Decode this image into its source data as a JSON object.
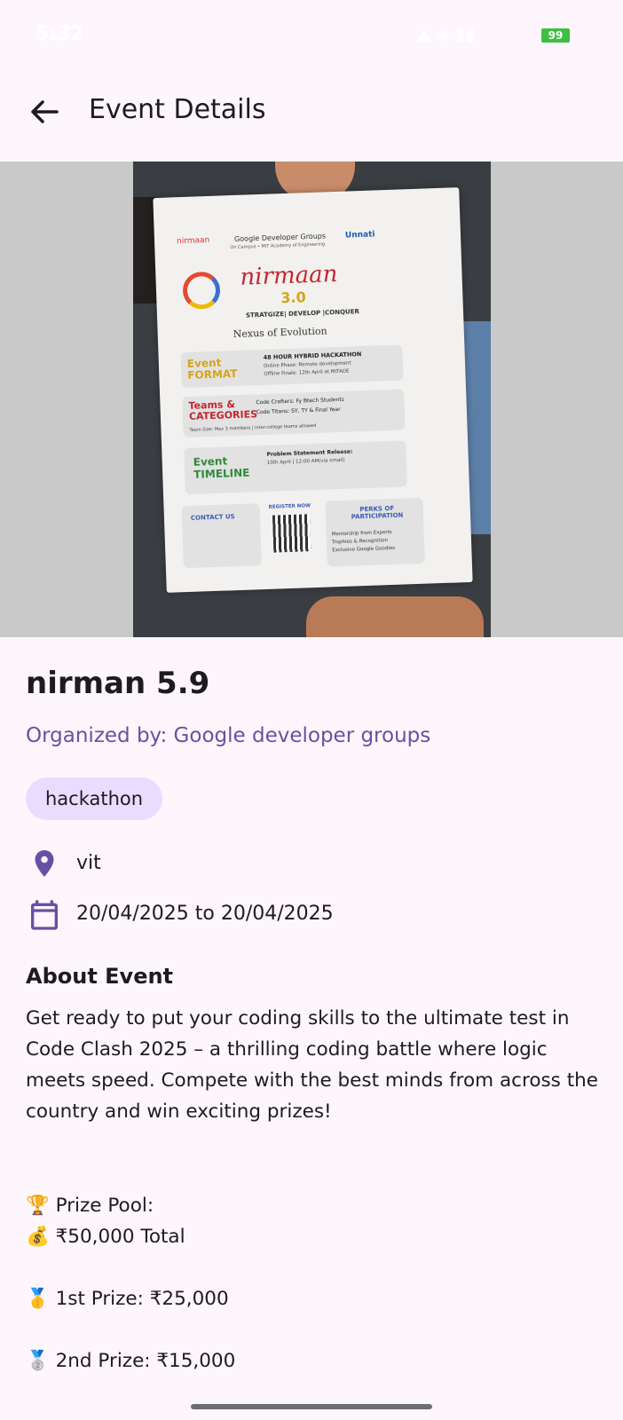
{
  "status_bar": {
    "time": "5:32",
    "battery": "99"
  },
  "app_bar": {
    "title": "Event Details"
  },
  "poster": {
    "brand_left": "nirmaan",
    "gdg": "Google Developer Groups",
    "gdg_sub": "On Campus • MIT Academy of Engineering",
    "brand_right": "Unnati",
    "logo": "nirmaan",
    "version": "3.0",
    "tagline": "STRATGIZE| DEVELOP |CONQUER",
    "nexus": "Nexus of Evolution",
    "format_title": "Event FORMAT",
    "format_line1": "48 HOUR HYBRID HACKATHON",
    "format_line2": "Online Phase: Remote development",
    "format_line3": "Offline Finale: 12th April at MITAOE",
    "teams_title": "Teams & CATEGORIES",
    "teams_line1": "Code Crafters: Fy Btech Students",
    "teams_line2": "Code Titans: SY, TY & Final Year",
    "teams_line3": "Team Size: Max 3 members | Inter-college teams allowed",
    "timeline_title": "Event TIMELINE",
    "timeline_line1": "Problem Statement Release:",
    "timeline_line2": "10th April | 12:00 AM(via email)",
    "contact_title": "CONTACT US",
    "register": "REGISTER NOW",
    "perks_title": "PERKS OF PARTICIPATION",
    "perks1": "Mentorship from Experts",
    "perks2": "Trophies & Recognition",
    "perks3": "Exclusive Google Goodies"
  },
  "event": {
    "name": "nirman 5.9",
    "organizer": "Organized by: Google developer groups",
    "category": "hackathon",
    "location": "vit",
    "dates": "20/04/2025 to 20/04/2025",
    "about_heading": "About Event",
    "about_text": "Get ready to put your coding skills to the ultimate test in Code Clash 2025 – a thrilling coding battle where logic meets speed. Compete with the best minds from across the country and win exciting prizes!",
    "prize_pool_label": "🏆 Prize Pool:",
    "prize_total": "💰 ₹50,000 Total",
    "first_prize": "🥇 1st Prize: ₹25,000",
    "second_prize": "🥈 2nd Prize: ₹15,000"
  },
  "colors": {
    "accent": "#6750a4",
    "chip_bg": "#e9ddff",
    "background": "#fdf7fd"
  },
  "icons": {
    "back": "arrow-left-icon",
    "location": "location-pin-icon",
    "calendar": "calendar-icon"
  }
}
